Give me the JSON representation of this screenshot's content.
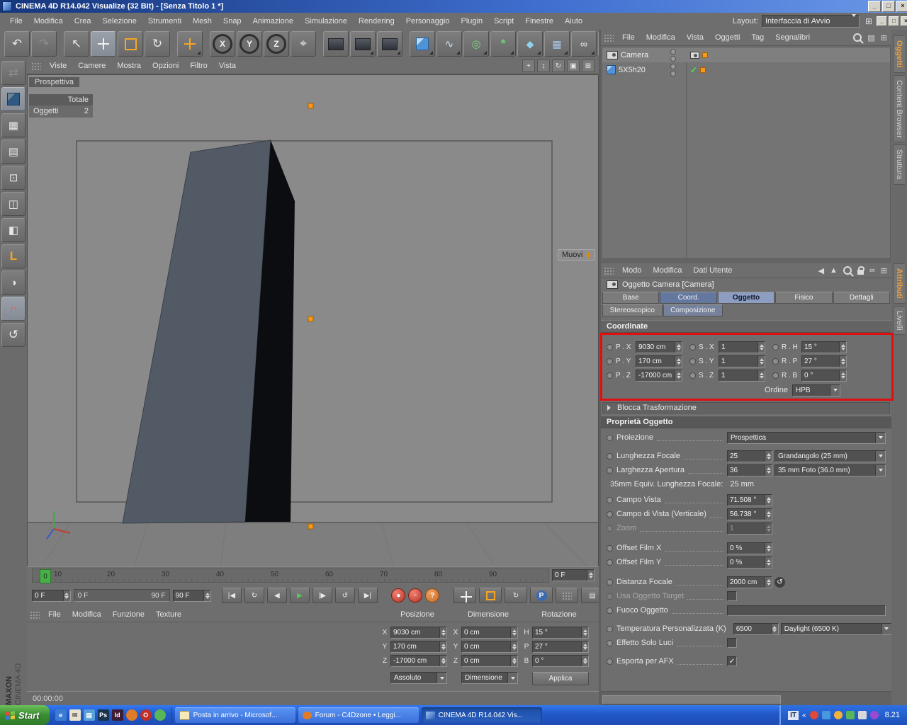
{
  "colors": {
    "accent_orange": "#f59a1c",
    "annotation_red": "#e01010",
    "play_green": "#59c659"
  },
  "window": {
    "title": "CINEMA 4D R14.042 Visualize (32 Bit) - [Senza Titolo 1 *]",
    "minimize_glyph": "_",
    "maximize_glyph": "□",
    "close_glyph": "×"
  },
  "menubar": {
    "items": [
      "File",
      "Modifica",
      "Crea",
      "Selezione",
      "Strumenti",
      "Mesh",
      "Snap",
      "Animazione",
      "Simulazione",
      "Rendering",
      "Personaggio",
      "Plugin",
      "Script",
      "Finestre",
      "Aiuto"
    ],
    "layout_label": "Layout:",
    "layout_value": "Interfaccia di Avvio"
  },
  "toolbar": {
    "axis_x": "X",
    "axis_y": "Y",
    "axis_z": "Z"
  },
  "viewport": {
    "menus": [
      "Viste",
      "Camere",
      "Mostra",
      "Opzioni",
      "Filtro",
      "Vista"
    ],
    "view_label": "Prospettiva",
    "stats": {
      "header": "Totale",
      "row_label": "Oggetti",
      "row_value": "2"
    },
    "move_hint": "Muovi"
  },
  "timeline": {
    "ticks": [
      "0",
      "10",
      "20",
      "30",
      "40",
      "50",
      "60",
      "70",
      "80",
      "90"
    ],
    "current_frame": "0",
    "frame_field": "0 F",
    "start_field": "0 F",
    "range_start": "0 F",
    "range_end": "90 F",
    "end_field": "90 F",
    "p_icon": "P"
  },
  "coordinate_manager": {
    "menus": [
      "File",
      "Modifica",
      "Funzione",
      "Texture"
    ],
    "columns": [
      "Posizione",
      "Dimensione",
      "Rotazione"
    ],
    "rows": [
      {
        "pa": "X",
        "pv": "9030 cm",
        "da": "X",
        "dv": "0 cm",
        "ra": "H",
        "rv": "15 °"
      },
      {
        "pa": "Y",
        "pv": "170 cm",
        "da": "Y",
        "dv": "0 cm",
        "ra": "P",
        "rv": "27 °"
      },
      {
        "pa": "Z",
        "pv": "-17000 cm",
        "da": "Z",
        "dv": "0 cm",
        "ra": "B",
        "rv": "0 °"
      }
    ],
    "mode_position": "Assoluto",
    "mode_size": "Dimensione",
    "apply_label": "Applica"
  },
  "status": {
    "time": "00:00:00"
  },
  "logo": {
    "line1": "MAXON",
    "line2": "CINEMA 4D"
  },
  "object_manager": {
    "menus": [
      "File",
      "Modifica",
      "Vista",
      "Oggetti",
      "Tag",
      "Segnalibri"
    ],
    "objects": [
      {
        "name": "Camera"
      },
      {
        "name": "5X5h20"
      }
    ]
  },
  "attribute_manager": {
    "menus": [
      "Modo",
      "Modifica",
      "Dati Utente"
    ],
    "title": "Oggetto Camera [Camera]",
    "tabs": [
      "Base",
      "Coord.",
      "Oggetto",
      "Fisico",
      "Dettagli"
    ],
    "tabs2": [
      "Stereoscopico",
      "Composizione"
    ],
    "coordinate_section": "Coordinate",
    "coords": [
      {
        "pl": "P . X",
        "pv": "9030 cm",
        "sl": "S . X",
        "sv": "1",
        "rl": "R . H",
        "rv": "15 °"
      },
      {
        "pl": "P . Y",
        "pv": "170 cm",
        "sl": "S . Y",
        "sv": "1",
        "rl": "R . P",
        "rv": "27 °"
      },
      {
        "pl": "P . Z",
        "pv": "-17000 cm",
        "sl": "S . Z",
        "sv": "1",
        "rl": "R . B",
        "rv": "0 °"
      }
    ],
    "ordine_label": "Ordine",
    "ordine_value": "HPB",
    "blocca_label": "Blocca Trasformazione",
    "properties_section": "Proprietà Oggetto",
    "props": {
      "proiezione_label": "Proiezione",
      "proiezione_value": "Prospettica",
      "lunghezza_label": "Lunghezza Focale",
      "lunghezza_value": "25",
      "lunghezza_preset": "Grandangolo (25 mm)",
      "larghezza_label": "Larghezza Apertura",
      "larghezza_value": "36",
      "larghezza_preset": "35 mm Foto (36.0 mm)",
      "equiv_label": "35mm Equiv. Lunghezza Focale:",
      "equiv_value": "25 mm",
      "campo_label": "Campo Vista",
      "campo_value": "71.508 °",
      "campov_label": "Campo di Vista (Verticale)",
      "campov_value": "56.738 °",
      "zoom_label": "Zoom",
      "zoom_value": "1",
      "offsetx_label": "Offset Film X",
      "offsetx_value": "0 %",
      "offsety_label": "Offset Film Y",
      "offsety_value": "0 %",
      "distanza_label": "Distanza Focale",
      "distanza_value": "2000 cm",
      "usa_label": "Usa Oggetto Target",
      "fuoco_label": "Fuoco Oggetto",
      "temperatura_label": "Temperatura Personalizzata (K)",
      "temperatura_value": "6500",
      "temperatura_preset": "Daylight (6500 K)",
      "effetto_label": "Effetto Solo Luci",
      "esporta_label": "Esporta per AFX",
      "esporta_check": "✓"
    }
  },
  "right_tabs": {
    "top": [
      "Oggetti",
      "Content Browser",
      "Struttura"
    ],
    "bottom": [
      "Attributi",
      "Livelli"
    ]
  },
  "taskbar": {
    "start": "Start",
    "tasks": [
      "Posta in arrivo - Microsof...",
      "Forum - C4Dzone • Leggi...",
      "CINEMA 4D R14.042 Vis..."
    ],
    "lang": "IT",
    "clock": "8.21"
  }
}
